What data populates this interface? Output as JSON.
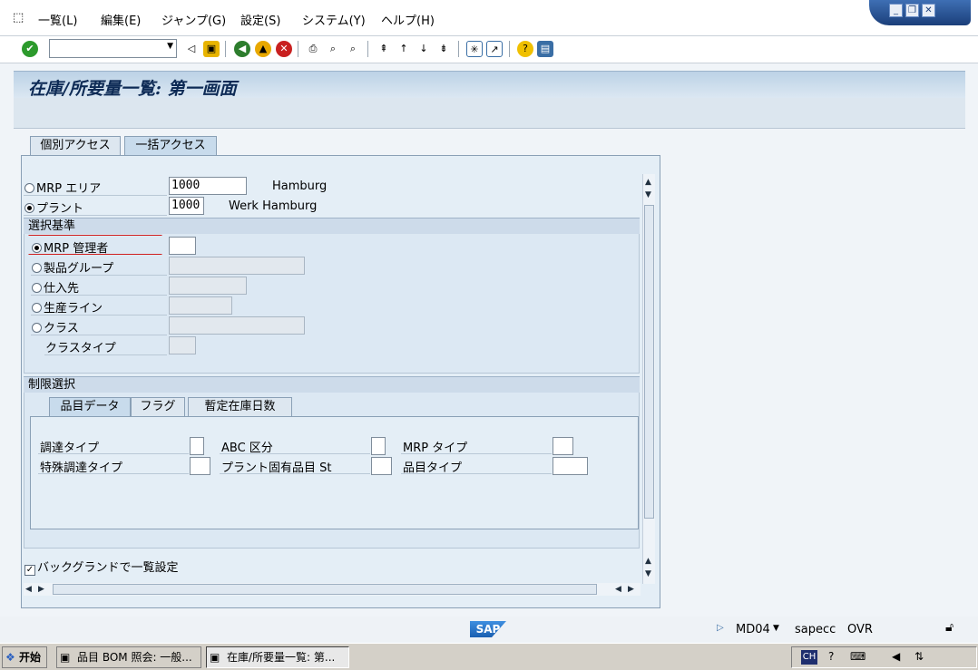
{
  "menu": {
    "items": [
      "一覧(L)",
      "編集(E)",
      "ジャンプ(G)",
      "設定(S)",
      "システム(Y)",
      "ヘルプ(H)"
    ]
  },
  "title": "在庫/所要量一覧: 第一画面",
  "tabs": {
    "individual": "個別アクセス",
    "collective": "一括アクセス"
  },
  "form": {
    "mrp_area_label": "MRP エリア",
    "mrp_area_value": "1000",
    "mrp_area_desc": "Hamburg",
    "plant_label": "プラント",
    "plant_value": "1000",
    "plant_desc": "Werk Hamburg"
  },
  "selection": {
    "header": "選択基準",
    "mrp_controller": "MRP 管理者",
    "material_group": "製品グループ",
    "vendor": "仕入先",
    "production_line": "生産ライン",
    "class": "クラス",
    "class_type": "クラスタイプ"
  },
  "restrict": {
    "header": "制限選択",
    "tabs": [
      "品目データ",
      "フラグ",
      "暫定在庫日数"
    ],
    "procurement_type": "調達タイプ",
    "abc": "ABC 区分",
    "mrp_type": "MRP タイプ",
    "special_procurement": "特殊調達タイプ",
    "plant_status": "プラント固有品目 St",
    "material_type": "品目タイプ"
  },
  "background": "バックグランドで一覧設定",
  "status": {
    "sap": "SAP",
    "tcode": "MD04",
    "server": "sapecc",
    "mode": "OVR"
  },
  "taskbar": {
    "start": "开始",
    "task1": "品目 BOM 照会: 一般...",
    "task2": "在庫/所要量一覧: 第...",
    "tray": "CH"
  }
}
